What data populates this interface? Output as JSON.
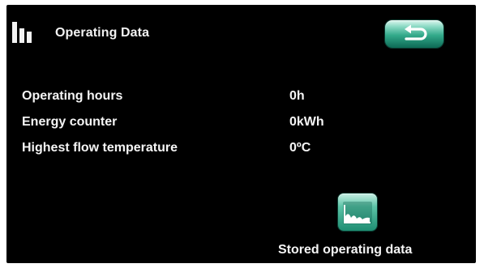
{
  "header": {
    "title": "Operating Data",
    "icon": "bar-chart-icon"
  },
  "back_button": {
    "icon": "return-arrow-icon"
  },
  "rows": [
    {
      "label": "Operating hours",
      "value": "0h"
    },
    {
      "label": "Energy counter",
      "value": "0kWh"
    },
    {
      "label": "Highest flow temperature",
      "value": "0ºC"
    }
  ],
  "stored_data_button": {
    "label": "Stored operating data",
    "icon": "line-graph-icon"
  },
  "colors": {
    "background": "#000000",
    "text": "#f5f5f5",
    "accent": "#32a98a"
  }
}
